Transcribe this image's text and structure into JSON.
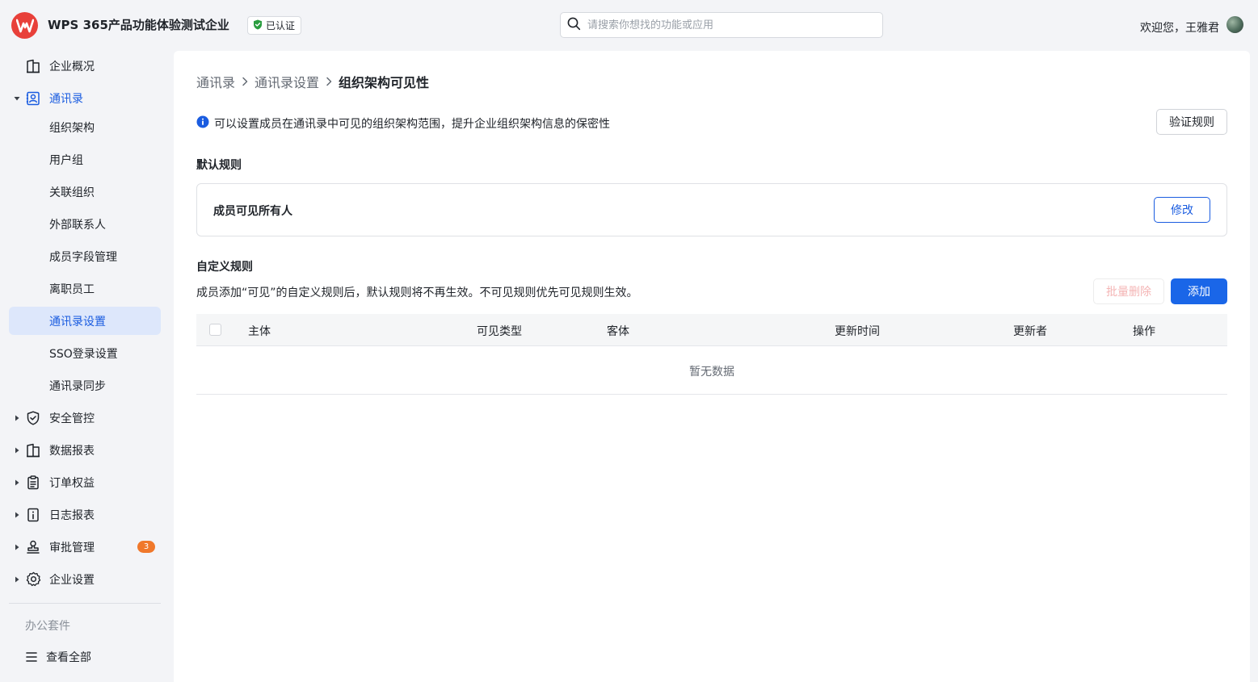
{
  "header": {
    "company_name": "WPS 365产品功能体验测试企业",
    "verified_label": "已认证",
    "search_placeholder": "请搜索你想找的功能或应用",
    "welcome_text": "欢迎您，王雅君"
  },
  "sidebar": {
    "items": [
      {
        "label": "企业概况",
        "icon": "building-icon"
      },
      {
        "label": "通讯录",
        "icon": "contacts-icon",
        "expanded": true
      },
      {
        "label": "组织架构"
      },
      {
        "label": "用户组"
      },
      {
        "label": "关联组织"
      },
      {
        "label": "外部联系人"
      },
      {
        "label": "成员字段管理"
      },
      {
        "label": "离职员工"
      },
      {
        "label": "通讯录设置",
        "active": true
      },
      {
        "label": "SSO登录设置"
      },
      {
        "label": "通讯录同步"
      },
      {
        "label": "安全管控",
        "icon": "shield-icon"
      },
      {
        "label": "数据报表",
        "icon": "report-icon"
      },
      {
        "label": "订单权益",
        "icon": "clipboard-icon"
      },
      {
        "label": "日志报表",
        "icon": "log-icon"
      },
      {
        "label": "审批管理",
        "icon": "stamp-icon",
        "badge": "3"
      },
      {
        "label": "企业设置",
        "icon": "gear-icon"
      }
    ],
    "section_label": "办公套件",
    "view_all_label": "查看全部"
  },
  "main": {
    "breadcrumb": [
      "通讯录",
      "通讯录设置",
      "组织架构可见性"
    ],
    "info_text": "可以设置成员在通讯录中可见的组织架构范围，提升企业组织架构信息的保密性",
    "verify_rules_button": "验证规则",
    "default_rules_title": "默认规则",
    "default_rule_text": "成员可见所有人",
    "modify_button": "修改",
    "custom_rules_title": "自定义规则",
    "custom_rules_desc": "成员添加“可见”的自定义规则后，默认规则将不再生效。不可见规则优先可见规则生效。",
    "batch_delete_button": "批量删除",
    "add_button": "添加",
    "table": {
      "columns": [
        "主体",
        "可见类型",
        "客体",
        "更新时间",
        "更新者",
        "操作"
      ],
      "empty_text": "暂无数据"
    }
  },
  "colors": {
    "accent": "#1a5ce0",
    "brand_logo": "#e8403a",
    "badge": "#f0782b",
    "verified_green": "#2a9d3f"
  }
}
